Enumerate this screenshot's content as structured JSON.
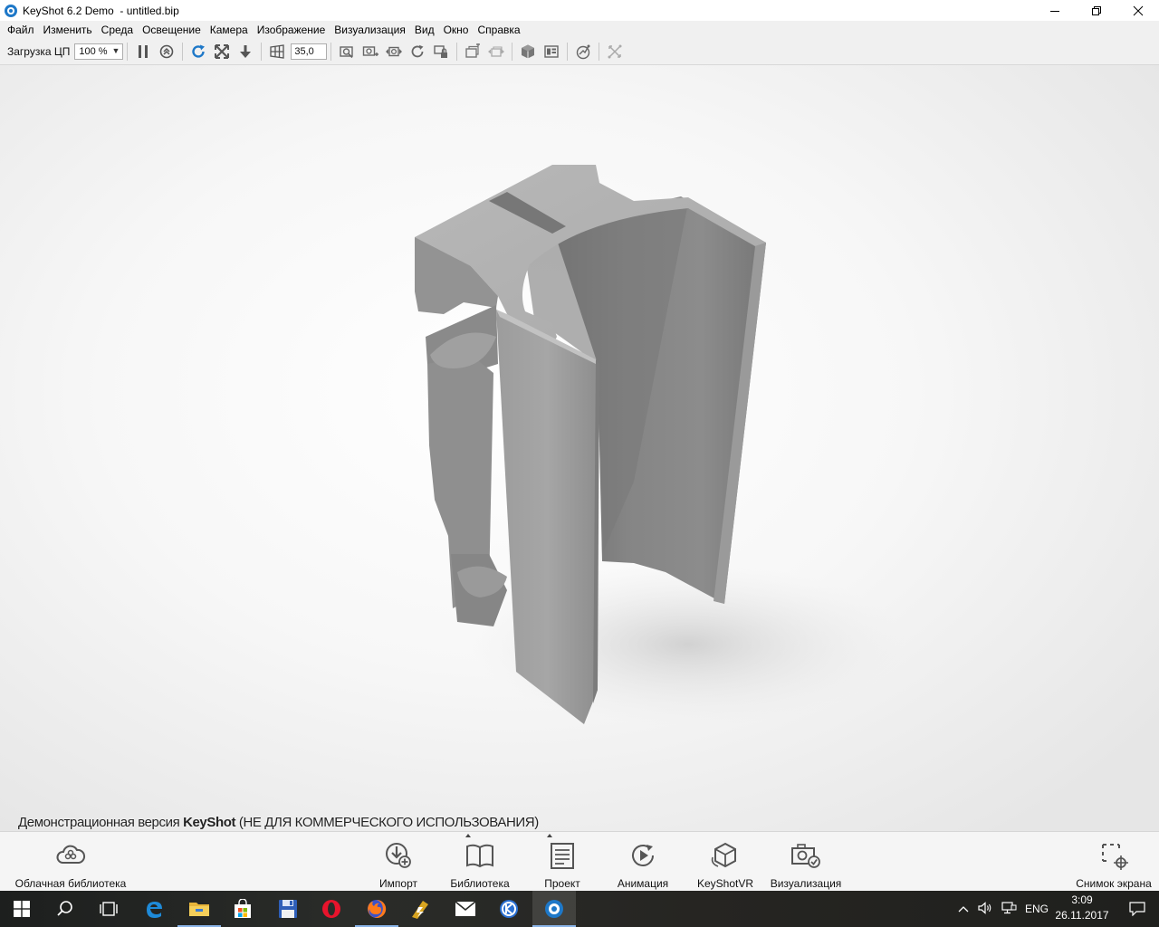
{
  "window": {
    "title": "KeyShot 6.2 Demo  - untitled.bip",
    "controls": [
      "minimize",
      "restore",
      "close"
    ]
  },
  "menu": {
    "items": [
      "Файл",
      "Изменить",
      "Среда",
      "Освещение",
      "Камера",
      "Изображение",
      "Визуализация",
      "Вид",
      "Окно",
      "Справка"
    ]
  },
  "toolbar": {
    "cpu_label": "Загрузка ЦП",
    "cpu_value": "100 %",
    "fov_value": "35,0"
  },
  "viewport": {
    "watermark_prefix": "Демонстрационная версия ",
    "watermark_brand": "KeyShot",
    "watermark_suffix": " (НЕ ДЛЯ КОММЕРЧЕСКОГО ИСПОЛЬЗОВАНИЯ)"
  },
  "ribbon": {
    "cloud_library": "Облачная библиотека",
    "import": "Импорт",
    "library": "Библиотека",
    "project": "Проект",
    "animation": "Анимация",
    "keyshotvr": "KeyShotVR",
    "render": "Визуализация",
    "screenshot": "Снимок экрана"
  },
  "taskbar": {
    "language": "ENG",
    "time": "3:09",
    "date": "26.11.2017"
  },
  "colors": {
    "accent": "#1e78c8",
    "taskbar_bg": "#252623"
  }
}
